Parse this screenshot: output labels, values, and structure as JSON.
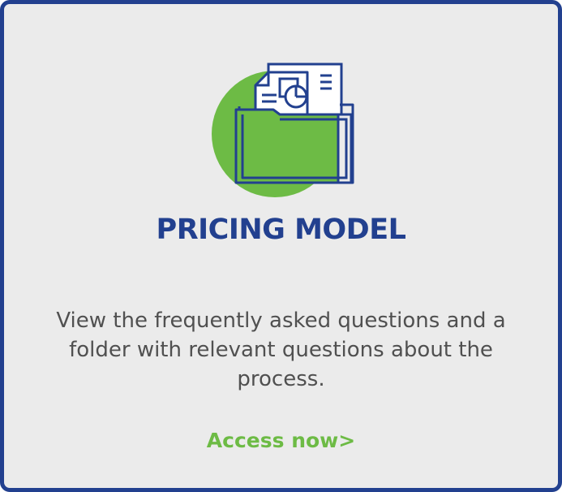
{
  "card": {
    "icon": "folder-with-documents-icon",
    "title": "PRICING MODEL",
    "description": "View the frequently asked questions and a folder with relevant questions about the process.",
    "cta_label": "Access now>"
  },
  "colors": {
    "brand_blue": "#22408f",
    "accent_green": "#6dbb45",
    "background": "#ebebeb",
    "text": "#505050"
  }
}
